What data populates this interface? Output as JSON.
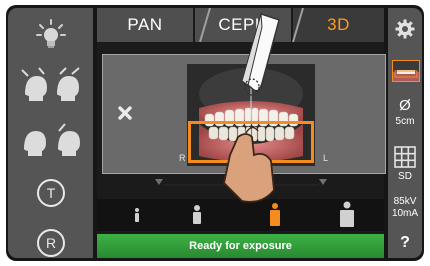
{
  "tabs": [
    {
      "label": "PAN",
      "active": false
    },
    {
      "label": "CEPH",
      "active": false
    },
    {
      "label": "3D",
      "active": true
    }
  ],
  "scan": {
    "left_label": "R",
    "right_label": "L"
  },
  "right_panel": {
    "diameter_symbol": "Ø",
    "diameter_value": "5cm",
    "resolution": "SD",
    "kv": "85kV",
    "ma": "10mA",
    "help": "?"
  },
  "left_panel": {
    "t_label": "T",
    "r_label": "R"
  },
  "status": {
    "text": "Ready for exposure"
  },
  "colors": {
    "accent": "#f58c1f",
    "ready": "#33a53c"
  },
  "icons": [
    "light-icon",
    "settings-gear-icon",
    "close-icon",
    "grid-icon",
    "tap-hand-icon",
    "drag-finger-icon"
  ],
  "patient_sizes": [
    "child",
    "small",
    "medium",
    "large"
  ],
  "selected_patient_size": "medium"
}
